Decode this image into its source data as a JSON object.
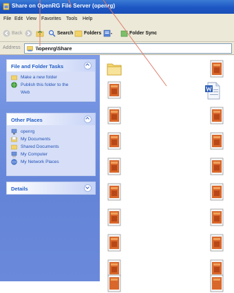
{
  "window": {
    "title": "Share on OpenRG File Server (openrg)"
  },
  "menu": {
    "items": [
      "File",
      "Edit",
      "View",
      "Favorites",
      "Tools",
      "Help"
    ]
  },
  "toolbar": {
    "back_label": "Back",
    "search_label": "Search",
    "folders_label": "Folders",
    "folder_sync_label": "Folder Sync"
  },
  "address": {
    "label": "Address",
    "value": "\\\\openrg\\Share"
  },
  "tasks_panel": {
    "title": "File and Folder Tasks",
    "items": [
      "Make a new folder",
      "Publish this folder to the",
      "Web"
    ]
  },
  "places_panel": {
    "title": "Other Places",
    "items": [
      "openrg",
      "My Documents",
      "Shared Documents",
      "My Computer",
      "My Network Places"
    ]
  },
  "details_panel": {
    "title": "Details"
  },
  "colors": {
    "titlebar": "#1c56c4",
    "left_pane": "#6b89da",
    "panel_bg": "#d6dff7",
    "panel_title": "#215dc6",
    "annotation_line": "#e07a6a"
  },
  "files": {
    "left_column": [
      "folder-icon",
      "archive-file-icon",
      "archive-file-icon",
      "archive-file-icon",
      "archive-file-icon",
      "archive-file-icon",
      "archive-file-icon",
      "archive-file-icon",
      "archive-file-icon",
      "archive-file-icon",
      "archive-file-icon"
    ],
    "right_column": [
      "archive-file-icon",
      "word-document-icon",
      "archive-file-icon",
      "archive-file-icon",
      "archive-file-icon",
      "archive-file-icon",
      "archive-file-icon",
      "archive-file-icon",
      "archive-file-icon",
      "archive-file-icon"
    ]
  }
}
